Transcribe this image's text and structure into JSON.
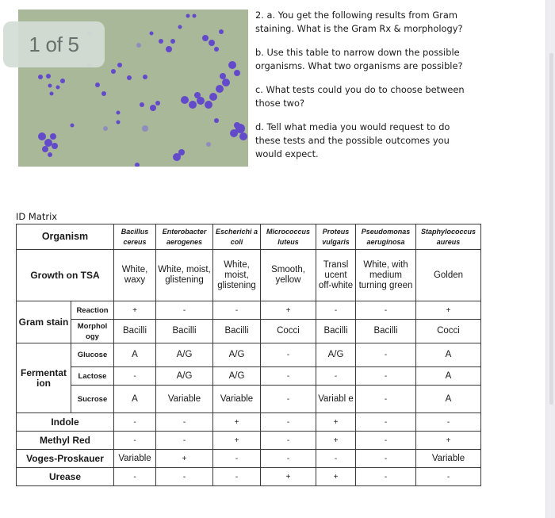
{
  "slideshow": {
    "counter": "1 of 5",
    "image_alt": "Gram stain micrograph showing purple cocci clusters"
  },
  "questions": {
    "a": "2. a. You get the following results from Gram staining. What is the Gram Rx & morphology?",
    "b": "b. Use this table to narrow down the possible organisms. What two organisms are possible?",
    "c": "c. What tests could you do to choose between those two?",
    "d": "d. Tell what media you would request to do these tests and the possible outcomes you would expect."
  },
  "matrix": {
    "title": "ID Matrix",
    "header_label": "Organism",
    "organisms": [
      "Bacillus cereus",
      "Enterobacter aerogenes",
      "Escherichi a coli",
      "Micrococcus luteus",
      "Proteus vulgaris",
      "Pseudomonas aeruginosa",
      "Staphylococcus aureus"
    ],
    "growth": {
      "label": "Growth on TSA",
      "values": [
        "White, waxy",
        "White, moist, glistening",
        "White, moist, glistening",
        "Smooth, yellow",
        "Transl ucent off-white",
        "White, with medium turning green",
        "Golden"
      ]
    },
    "gram_stain": {
      "label": "Gram stain",
      "reaction": {
        "label": "Reaction",
        "values": [
          "+",
          "-",
          "-",
          "+",
          "-",
          "-",
          "+"
        ]
      },
      "morphology": {
        "label": "Morphol ogy",
        "values": [
          "Bacilli",
          "Bacilli",
          "Bacilli",
          "Cocci",
          "Bacilli",
          "Bacilli",
          "Cocci"
        ]
      }
    },
    "fermentation": {
      "label": "Fermentat ion",
      "glucose": {
        "label": "Glucose",
        "values": [
          "A",
          "A/G",
          "A/G",
          "-",
          "A/G",
          "-",
          "A"
        ]
      },
      "lactose": {
        "label": "Lactose",
        "values": [
          "-",
          "A/G",
          "A/G",
          "-",
          "-",
          "-",
          "A"
        ]
      },
      "sucrose": {
        "label": "Sucrose",
        "values": [
          "A",
          "Variable",
          "Variable",
          "-",
          "Variabl e",
          "-",
          "A"
        ]
      }
    },
    "indole": {
      "label": "Indole",
      "values": [
        "-",
        "-",
        "+",
        "-",
        "+",
        "-",
        "-"
      ]
    },
    "methyl_red": {
      "label": "Methyl Red",
      "values": [
        "-",
        "-",
        "+",
        "-",
        "+",
        "-",
        "+"
      ]
    },
    "voges_proskauer": {
      "label": "Voges-Proskauer",
      "values": [
        "Variable",
        "+",
        "-",
        "-",
        "-",
        "-",
        "Variable"
      ]
    },
    "urease": {
      "label": "Urease",
      "values": [
        "-",
        "-",
        "-",
        "+",
        "+",
        "-",
        "-"
      ]
    }
  }
}
